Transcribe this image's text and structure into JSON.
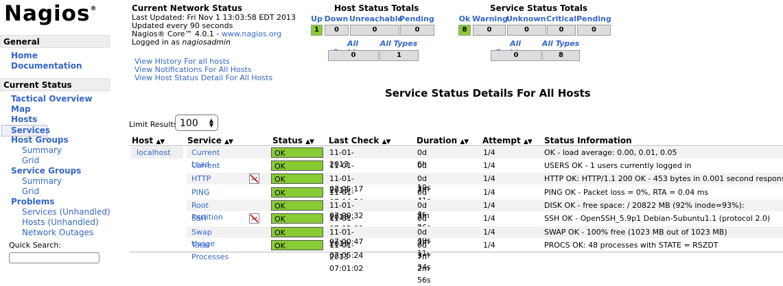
{
  "logo": {
    "text": "Nagios",
    "mark": "®"
  },
  "sidebar": {
    "general": "General",
    "home": "Home",
    "documentation": "Documentation",
    "current_status": "Current Status",
    "tactical": "Tactical Overview",
    "map": "Map",
    "hosts": "Hosts",
    "services": "Services",
    "host_groups": "Host Groups",
    "hg_summary": "Summary",
    "hg_grid": "Grid",
    "service_groups": "Service Groups",
    "sg_summary": "Summary",
    "sg_grid": "Grid",
    "problems": "Problems",
    "p_services": "Services",
    "p_hosts": "Hosts",
    "unhandled": "(Unhandled)",
    "network_outages": "Network Outages",
    "quick_search": "Quick Search:"
  },
  "network_status": {
    "title": "Current Network Status",
    "updated": "Last Updated: Fri Nov 1 13:03:58 EDT 2013",
    "interval": "Updated every 90 seconds",
    "core": "Nagios® Core™ 4.0.1 - ",
    "core_link": "www.nagios.org",
    "logged_prefix": "Logged in as ",
    "user": "nagiosadmin",
    "link_history": "View History For all hosts",
    "link_notifications": "View Notifications For All Hosts",
    "link_host_detail": "View Host Status Detail For All Hosts"
  },
  "host_totals": {
    "title": "Host Status Totals",
    "headers": [
      "Up",
      "Down",
      "Unreachable",
      "Pending"
    ],
    "values": [
      "1",
      "0",
      "0",
      "0"
    ],
    "sub_headers": [
      "All Problems",
      "All Types"
    ],
    "sub_values": [
      "0",
      "1"
    ]
  },
  "service_totals": {
    "title": "Service Status Totals",
    "headers": [
      "Ok",
      "Warning",
      "Unknown",
      "Critical",
      "Pending"
    ],
    "values": [
      "8",
      "0",
      "0",
      "0",
      "0"
    ],
    "sub_headers": [
      "All Problems",
      "All Types"
    ],
    "sub_values": [
      "0",
      "8"
    ]
  },
  "details": {
    "title": "Service Status Details For All Hosts",
    "limit_label": "Limit Results:",
    "limit_value": "100",
    "columns": [
      "Host",
      "Service",
      "Status",
      "Last Check",
      "Duration",
      "Attempt",
      "Status Information"
    ],
    "host": "localhost",
    "rows": [
      {
        "service": "Current Load",
        "status": "OK",
        "last_check": "11-01-2013 07:04:39",
        "duration": "0d 6h 59m 19s",
        "attempt": "1/4",
        "info": "OK - load average: 0.00, 0.01, 0.05"
      },
      {
        "service": "Current Users",
        "status": "OK",
        "last_check": "11-01-2013 07:05:17",
        "duration": "0d 7h 3m 41s",
        "attempt": "1/4",
        "info": "USERS OK - 1 users currently logged in"
      },
      {
        "service": "HTTP",
        "status": "OK",
        "last_check": "11-01-2013 07:04:54",
        "duration": "0d 7h 4m 4s",
        "attempt": "1/4",
        "info": "HTTP OK: HTTP/1.1 200 OK - 453 bytes in 0.001 second response time"
      },
      {
        "service": "PING",
        "status": "OK",
        "last_check": "11-01-2013 07:00:32",
        "duration": "0d 7h 3m 26s",
        "attempt": "1/4",
        "info": "PING OK - Packet loss = 0%, RTA = 0.04 ms"
      },
      {
        "service": "Root Partition",
        "status": "OK",
        "last_check": "11-01-2013 07:05:09",
        "duration": "0d 7h 3m 49s",
        "attempt": "1/4",
        "info": "DISK OK - free space: / 20822 MB (92% inode=93%):"
      },
      {
        "service": "SSH",
        "status": "OK",
        "last_check": "11-01-2013 07:00:47",
        "duration": "0d 7h 3m 11s",
        "attempt": "1/4",
        "info": "SSH OK - OpenSSH_5.9p1 Debian-5ubuntu1.1 (protocol 2.0)"
      },
      {
        "service": "Swap Usage",
        "status": "OK",
        "last_check": "11-01-2013 07:05:24",
        "duration": "0d 7h 3m 34s",
        "attempt": "1/4",
        "info": "SWAP OK - 100% free (1023 MB out of 1023 MB)"
      },
      {
        "service": "Total Processes",
        "status": "OK",
        "last_check": "11-01-2013 07:01:02",
        "duration": "0d 7h 2m 56s",
        "attempt": "1/4",
        "info": "PROCS OK: 48 processes with STATE = RSZDT"
      }
    ]
  },
  "colors": {
    "ok": "#88cc33",
    "link": "#3366cc"
  }
}
